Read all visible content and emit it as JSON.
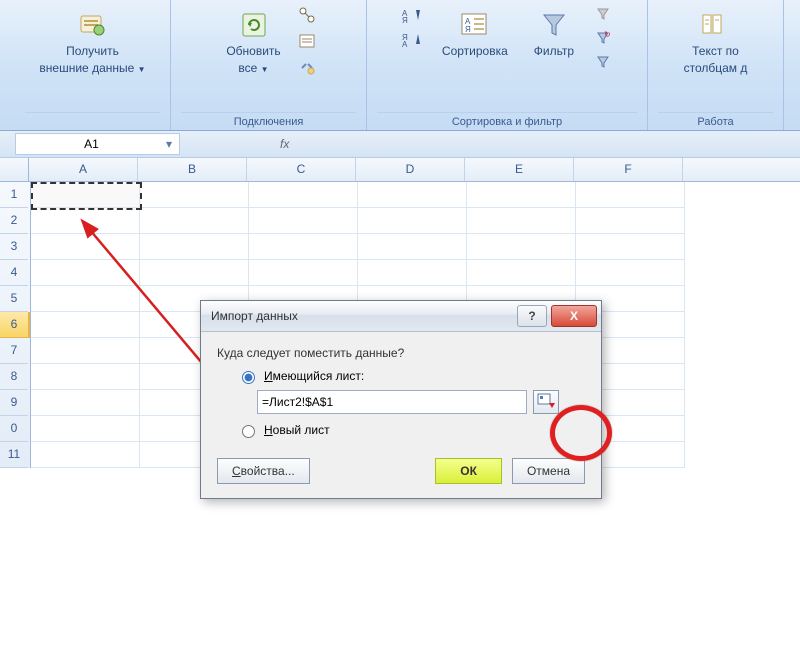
{
  "ribbon": {
    "getData": {
      "label1": "Получить",
      "label2": "внешние данные"
    },
    "refresh": {
      "label1": "Обновить",
      "label2": "все"
    },
    "connGroup": "Подключения",
    "sort": "Сортировка",
    "filter": "Фильтр",
    "sortFilterGroup": "Сортировка и фильтр",
    "textToCols1": "Текст по",
    "textToCols2": "столбцам д",
    "dataToolsGroup": "Работа"
  },
  "namebox": "A1",
  "fx": "fx",
  "columns": [
    "A",
    "B",
    "C",
    "D",
    "E",
    "F"
  ],
  "rows": [
    "1",
    "2",
    "3",
    "4",
    "5",
    "6",
    "7",
    "8",
    "9",
    "0",
    "11"
  ],
  "highlightRow": 5,
  "dialog": {
    "title": "Импорт данных",
    "help": "?",
    "close": "X",
    "question": "Куда следует поместить данные?",
    "existingLabel": "Имеющийся лист:",
    "cellRefValue": "=Лист2!$A$1",
    "newLabel": "Новый лист",
    "properties": "Свойства...",
    "ok": "ОК",
    "cancel": "Отмена"
  }
}
